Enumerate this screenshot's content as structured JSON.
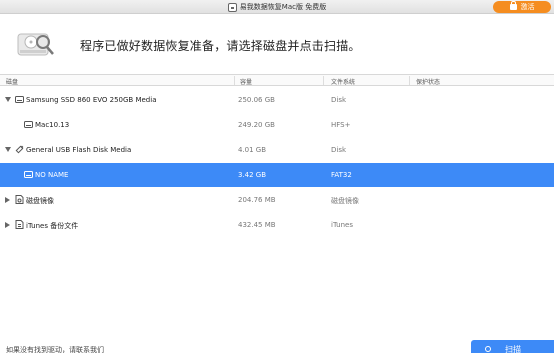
{
  "window": {
    "title": "易我数据恢复Mac版 免费版",
    "activate_label": "激活"
  },
  "header": {
    "headline": "程序已做好数据恢复准备，请选择磁盘并点击扫描。"
  },
  "table": {
    "columns": [
      "磁盘",
      "容量",
      "文件系统",
      "保护状态"
    ],
    "rows": [
      {
        "name": "Samsung SSD 860 EVO 250GB Media",
        "capacity": "250.06 GB",
        "fs": "Disk",
        "icon": "hard-drive-icon",
        "expander": "expanded"
      },
      {
        "name": "Mac10.13",
        "capacity": "249.20 GB",
        "fs": "HFS+",
        "icon": "volume-icon",
        "expander": "none"
      },
      {
        "name": "General USB Flash Disk Media",
        "capacity": "4.01 GB",
        "fs": "Disk",
        "icon": "usb-drive-icon",
        "expander": "expanded"
      },
      {
        "name": "NO NAME",
        "capacity": "3.42 GB",
        "fs": "FAT32",
        "icon": "volume-icon",
        "expander": "none",
        "selected": true
      },
      {
        "name": "磁盘镜像",
        "capacity": "204.76 MB",
        "fs": "磁盘镜像",
        "icon": "disk-image-icon",
        "expander": "collapsed"
      },
      {
        "name": "iTunes 备份文件",
        "capacity": "432.45 MB",
        "fs": "iTunes",
        "icon": "itunes-backup-icon",
        "expander": "collapsed"
      }
    ]
  },
  "footer": {
    "help_text": "如果没有找到驱动，请联系我们",
    "scan_label": "扫描"
  },
  "colors": {
    "accent": "#3d8af7",
    "activate": "#f58d20"
  }
}
